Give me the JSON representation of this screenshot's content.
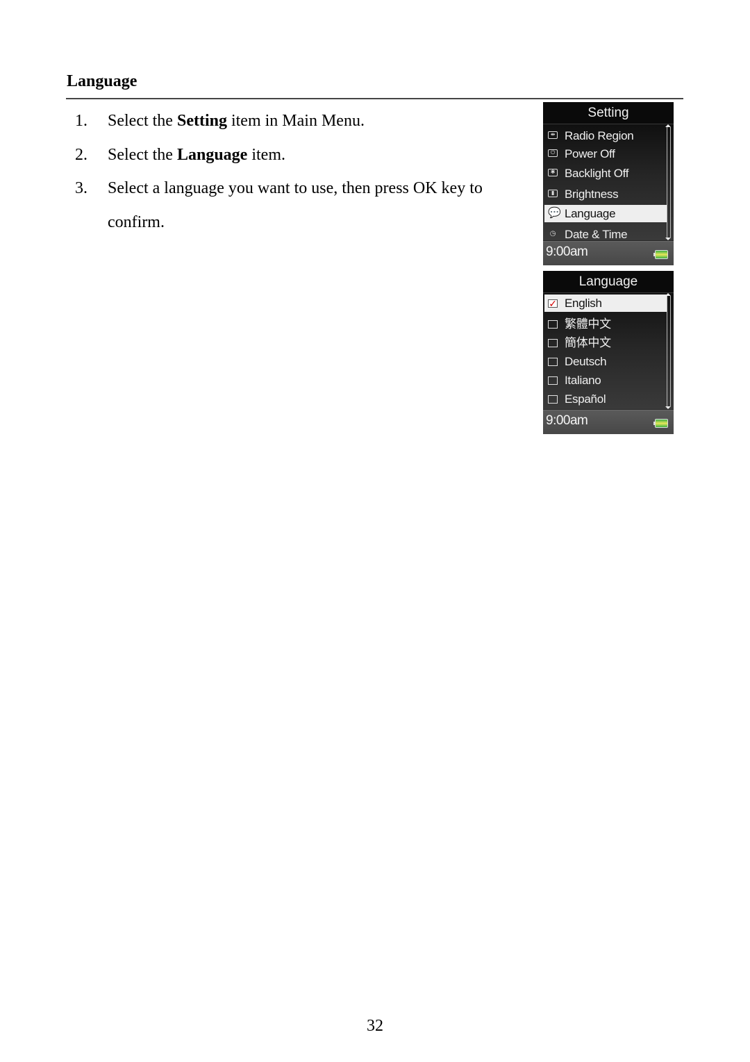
{
  "section_title": "Language",
  "steps": [
    {
      "num": "1.",
      "pre": "Select the ",
      "bold": "Setting",
      "post": " item in Main Menu."
    },
    {
      "num": "2.",
      "pre": "Select the ",
      "bold": "Language",
      "post": " item."
    },
    {
      "num": "3.",
      "pre": "Select a language you want to use, then press OK key to confirm.",
      "bold": "",
      "post": ""
    }
  ],
  "page_number": "32",
  "screens": {
    "setting": {
      "title": "Setting",
      "items": [
        {
          "icon": "radio-region-icon",
          "glyph": "⇼",
          "label": "Radio Region",
          "selected": false
        },
        {
          "icon": "power-off-icon",
          "glyph": "⏻",
          "label": "Power Off",
          "selected": false
        },
        {
          "icon": "backlight-off-icon",
          "glyph": "✱",
          "label": "Backlight Off",
          "selected": false
        },
        {
          "icon": "brightness-icon",
          "glyph": "▮",
          "label": "Brightness",
          "selected": false
        },
        {
          "icon": "language-bubble-icon",
          "glyph": "💬",
          "label": "Language",
          "selected": true
        },
        {
          "icon": "date-time-icon",
          "glyph": "◷",
          "label": "Date & Time",
          "selected": false
        }
      ],
      "time": "9:00am",
      "battery_icon": "battery-full-icon"
    },
    "language": {
      "title": "Language",
      "items": [
        {
          "label": "English",
          "checked": true,
          "check_glyph": "✓"
        },
        {
          "label": "繁體中文",
          "checked": false,
          "check_glyph": ""
        },
        {
          "label": "簡体中文",
          "checked": false,
          "check_glyph": ""
        },
        {
          "label": "Deutsch",
          "checked": false,
          "check_glyph": ""
        },
        {
          "label": "Italiano",
          "checked": false,
          "check_glyph": ""
        },
        {
          "label": "Español",
          "checked": false,
          "check_glyph": ""
        }
      ],
      "time": "9:00am",
      "battery_icon": "battery-full-icon"
    }
  }
}
